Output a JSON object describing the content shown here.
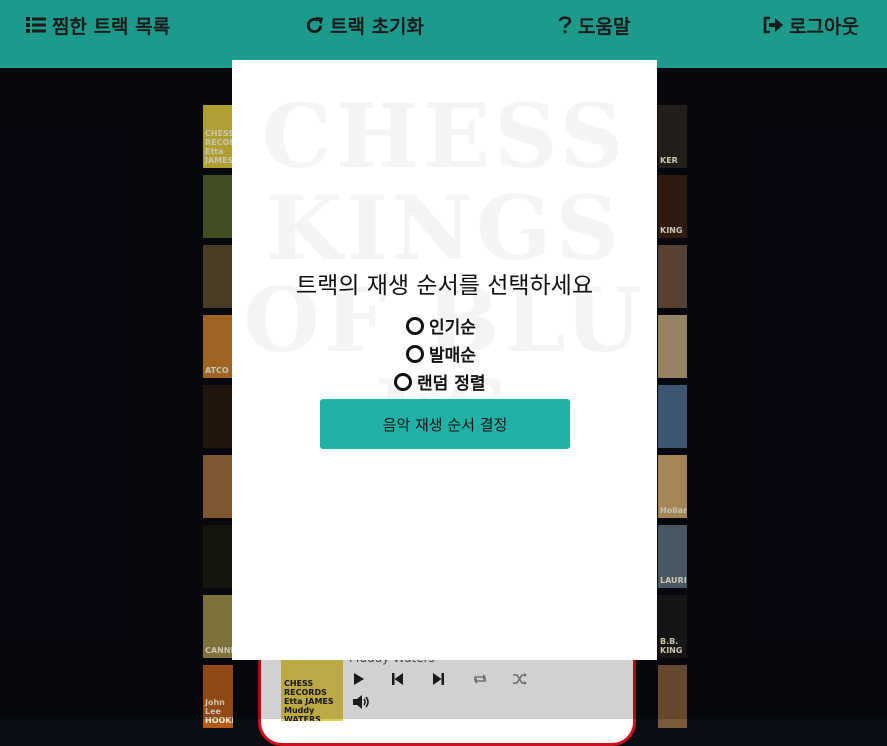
{
  "nav": {
    "liked_tracks": "찜한 트랙 목록",
    "reset_tracks": "트랙 초기화",
    "help": "도움말",
    "logout": "로그아웃"
  },
  "album_covers": {
    "left": [
      {
        "label": "CHESS RECORDS Etta JAMES",
        "color": "#d6c23c"
      },
      {
        "label": "",
        "color": "#51602a"
      },
      {
        "label": "",
        "color": "#5b4a2e"
      },
      {
        "label": "ATCO",
        "color": "#c27a2a"
      },
      {
        "label": "",
        "color": "#2a1a10"
      },
      {
        "label": "",
        "color": "#9a6a3a"
      },
      {
        "label": "",
        "color": "#1a1a12"
      },
      {
        "label": "CANNED",
        "color": "#9a8a4a"
      },
      {
        "label": "John Lee HOOKER",
        "color": "#b35a1a"
      }
    ],
    "right": [
      {
        "label": "KER",
        "color": "#2a2420"
      },
      {
        "label": "KING",
        "color": "#3a2016"
      },
      {
        "label": "",
        "color": "#6a5040"
      },
      {
        "label": "",
        "color": "#b7a07a"
      },
      {
        "label": "",
        "color": "#4a6a8a"
      },
      {
        "label": "Holland",
        "color": "#c9a46a"
      },
      {
        "label": "LAURIE",
        "color": "#5a6a7a"
      },
      {
        "label": "B.B. KING",
        "color": "#1a1a1a"
      },
      {
        "label": "",
        "color": "#7a5a3a"
      }
    ]
  },
  "player": {
    "artist": "Muddy Waters",
    "art_label": "CHESS RECORDS Etta JAMES Muddy WATERS Chuck BERRY",
    "controls": [
      "play-icon",
      "previous-icon",
      "next-icon",
      "repeat-icon",
      "shuffle-icon",
      "volume-icon"
    ]
  },
  "modal": {
    "background_text": "CHESS KINGS OF BLUES",
    "title": "트랙의 재생 순서를 선택하세요",
    "options": {
      "popular": "인기순",
      "release": "발매순",
      "random": "랜덤 정렬"
    },
    "confirm_label": "음악 재생 순서 결정"
  },
  "colors": {
    "topbar": "#1c9b8c",
    "button": "#20b2a7",
    "player_border": "#d0101c",
    "page_background": "#080a12"
  }
}
